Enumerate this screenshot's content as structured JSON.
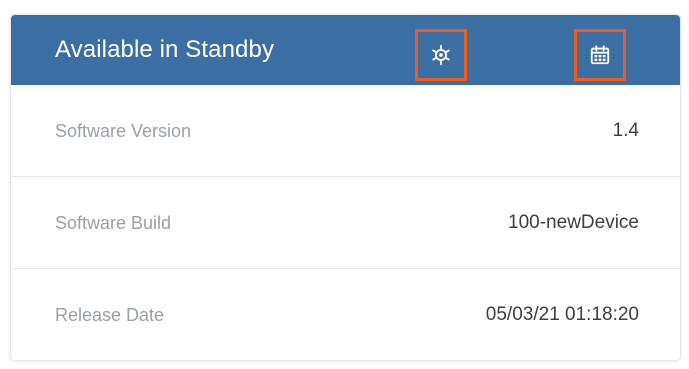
{
  "panel": {
    "title": "Available in Standby",
    "colors": {
      "header_bg": "#3b6fa3",
      "highlight_border": "#f05a1c"
    },
    "actions": [
      {
        "icon": "gear-icon"
      },
      {
        "icon": "calendar-icon"
      }
    ]
  },
  "rows": [
    {
      "label": "Software Version",
      "value": "1.4"
    },
    {
      "label": "Software Build",
      "value": "100-newDevice"
    },
    {
      "label": "Release Date",
      "value": "05/03/21 01:18:20"
    }
  ]
}
